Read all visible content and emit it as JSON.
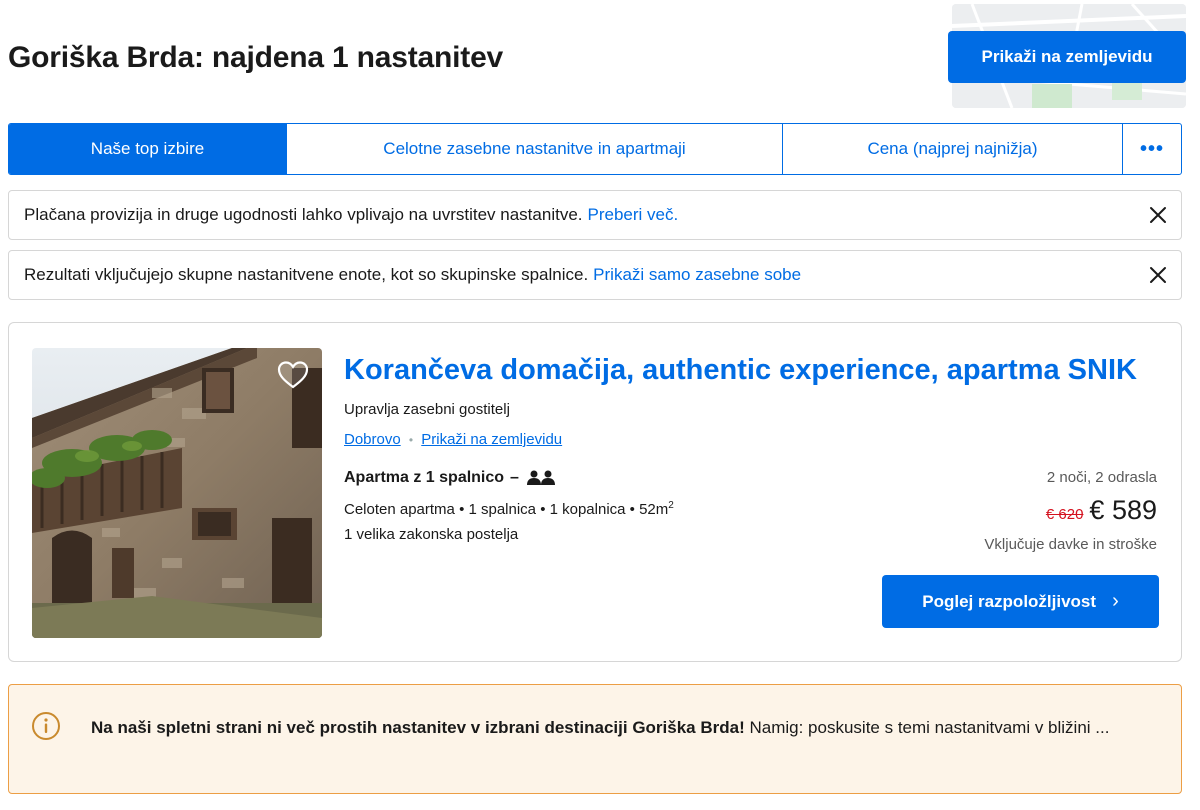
{
  "header": {
    "title": "Goriška Brda: najdena 1 nastanitev",
    "map_button": "Prikaži na zemljevidu"
  },
  "sort_tabs": [
    {
      "label": "Naše top izbire",
      "active": true
    },
    {
      "label": "Celotne zasebne nastanitve in apartmaji",
      "active": false
    },
    {
      "label": "Cena (najprej najnižja)",
      "active": false
    },
    {
      "label": "•••",
      "active": false
    }
  ],
  "notices": [
    {
      "text": "Plačana provizija in druge ugodnosti lahko vplivajo na uvrstitev nastanitve.",
      "link": "Preberi več."
    },
    {
      "text": "Rezultati vključujejo skupne nastanitvene enote, kot so skupinske spalnice.",
      "link": "Prikaži samo zasebne sobe"
    }
  ],
  "property": {
    "title": "Korančeva domačija, authentic experience, apartma SNIK",
    "host": "Upravlja zasebni gostitelj",
    "location": "Dobrovo",
    "map_link": "Prikaži na zemljevidu",
    "unit_name": "Apartma z 1 spalnico",
    "unit_sep": "–",
    "unit_details": "Celoten apartma • 1 spalnica • 1 kopalnica • 52m",
    "unit_details_sup": "2",
    "bed": "1 velika zakonska postelja",
    "stay": "2 noči, 2 odrasla",
    "old_price": "€ 620",
    "new_price": "€ 589",
    "tax_info": "Vključuje davke in stroške",
    "cta": "Poglej razpoložljivost",
    "cta_chevron": "›"
  },
  "alert": {
    "bold": "Na naši spletni strani ni več prostih nastanitev v izbrani destinaciji Goriška Brda!",
    "text": " Namig: poskusite s temi nastanitvami v bližini ..."
  },
  "colors": {
    "brand_blue": "#006ce4",
    "strike_red": "#d4111e",
    "alert_bg": "#fdf4e8",
    "alert_border": "#ec9e45"
  },
  "icons": {
    "close": "close-icon",
    "heart": "heart-icon",
    "guests": "two-guests-icon",
    "info": "info-icon",
    "chevron": "chevron-right-icon"
  }
}
